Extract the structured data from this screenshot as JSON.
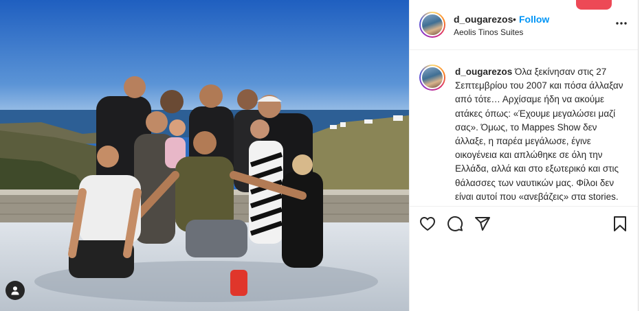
{
  "post": {
    "username": "d_ougarezos",
    "separator": "•",
    "follow_label": "Follow",
    "location": "Aeolis Tinos Suites",
    "caption_username": "d_ougarezos",
    "caption_text": "Όλα ξεκίνησαν στις 27 Σεπτεμβρίου του 2007 και πόσα άλλαξαν από τότε… Αρχίσαμε ήδη να ακούμε ατάκες όπως: «Έχουμε μεγαλώσει μαζί σας». Όμως, το Mappes Show δεν άλλαξε, η παρέα μεγάλωσε, έγινε οικογένεια και απλώθηκε σε όλη την Ελλάδα, αλλά και στο εξωτερικό και στις θάλασσες των ναυτικών μας. Φίλοι δεν είναι αυτοί που «ανεβάζεις» στα stories."
  },
  "icons": {
    "more": "more-options-icon",
    "like": "heart-icon",
    "comment": "comment-icon",
    "share": "share-icon",
    "save": "bookmark-icon",
    "user_tag": "user-tag-icon"
  },
  "colors": {
    "link_blue": "#0095f6",
    "text": "#262626",
    "notification_red": "#ed4956"
  }
}
